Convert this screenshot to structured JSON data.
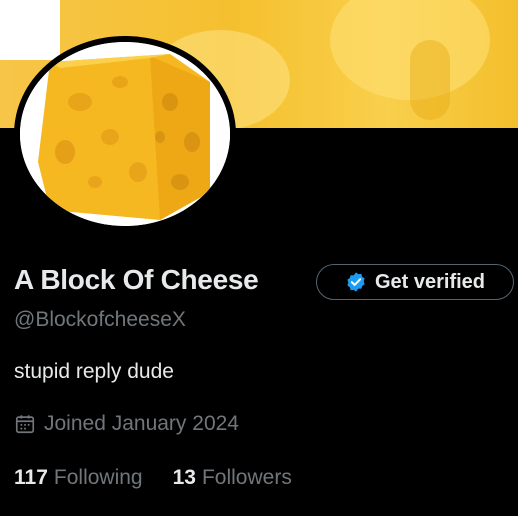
{
  "profile": {
    "display_name": "A Block Of Cheese",
    "handle": "@BlockofcheeseX",
    "bio": "stupid reply dude",
    "joined": "Joined January 2024",
    "verify_button_label": "Get verified"
  },
  "stats": {
    "following_count": "117",
    "following_label": "Following",
    "followers_count": "13",
    "followers_label": "Followers"
  },
  "icons": {
    "verify": "verified-badge-icon",
    "calendar": "calendar-icon",
    "avatar": "cheese-block-image",
    "banner": "cheese-banner-image"
  },
  "colors": {
    "background": "#000000",
    "primary_text": "#e7e9ea",
    "secondary_text": "#71767b",
    "verified_blue": "#1d9bf0",
    "cheese_yellow": "#f5c02f"
  }
}
